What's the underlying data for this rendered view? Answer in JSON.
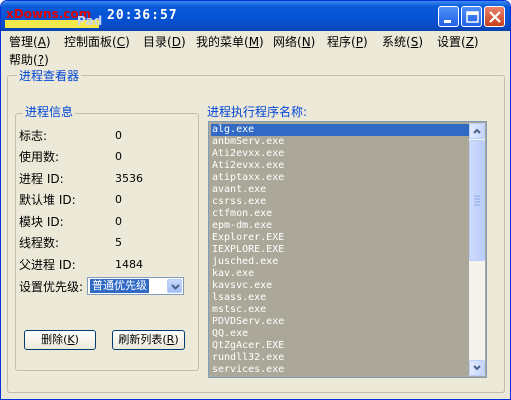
{
  "titlebar": {
    "watermark": "xDowns.com",
    "watermark_tail": "Pad",
    "clock": "20:36:57",
    "buttons": [
      "minimize",
      "maximize",
      "close"
    ]
  },
  "menu": [
    {
      "label": "管理(",
      "key": "A",
      "end": ")"
    },
    {
      "label": "控制面板(",
      "key": "C",
      "end": ")"
    },
    {
      "label": "目录(",
      "key": "D",
      "end": ")"
    },
    {
      "label": "我的菜单(",
      "key": "M",
      "end": ")"
    },
    {
      "label": "网络(",
      "key": "N",
      "end": ")"
    },
    {
      "label": "程序(",
      "key": "P",
      "end": ")"
    },
    {
      "label": "系统(",
      "key": "S",
      "end": ")"
    },
    {
      "label": "设置(",
      "key": "Z",
      "end": ")"
    },
    {
      "label": "帮助(",
      "key": "?",
      "end": ")"
    }
  ],
  "viewer": {
    "title": "进程查看器",
    "info_title": "进程信息",
    "info": [
      {
        "label": "标志:",
        "value": "0"
      },
      {
        "label": "使用数:",
        "value": "0"
      },
      {
        "label": "进程 ID:",
        "value": "3536"
      },
      {
        "label": "默认堆 ID:",
        "value": "0"
      },
      {
        "label": "模块 ID:",
        "value": "0"
      },
      {
        "label": "线程数:",
        "value": "5"
      },
      {
        "label": "父进程 ID:",
        "value": "1484"
      }
    ],
    "priority_label": "设置优先级:",
    "priority_value": "普通优先级",
    "delete_button": {
      "label": "删除(",
      "key": "K",
      "end": ")"
    },
    "refresh_button": {
      "label": "刷新列表(",
      "key": "R",
      "end": ")"
    },
    "list_title": "进程执行程序名称:",
    "processes": [
      "alg.exe",
      "anbmServ.exe",
      "Ati2evxx.exe",
      "Ati2evxx.exe",
      "atiptaxx.exe",
      "avant.exe",
      "csrss.exe",
      "ctfmon.exe",
      "epm-dm.exe",
      "Explorer.EXE",
      "IEXPLORE.EXE",
      "jusched.exe",
      "kav.exe",
      "kavsvc.exe",
      "lsass.exe",
      "mstsc.exe",
      "PDVDServ.exe",
      "QQ.exe",
      "QtZgAcer.EXE",
      "rundll32.exe",
      "services.exe"
    ],
    "selected_index": 0
  }
}
